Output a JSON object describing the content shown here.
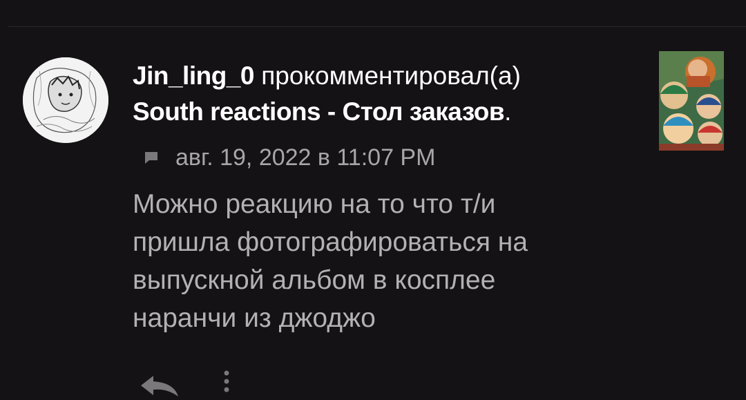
{
  "comment": {
    "username": "Jin_ling_0",
    "action_text": " прокомментировал(а)",
    "post_title": "South reactions - Стол заказов",
    "title_suffix": ".",
    "timestamp": "авг. 19, 2022 в 11:07 PM",
    "text": "Можно реакцию на то что т/и\nпришла фотографироваться на\nвыпускной альбом в косплее\nнаранчи из джоджо"
  },
  "icons": {
    "comment": "comment-icon",
    "reply": "reply-icon",
    "more": "more-vertical-icon"
  },
  "colors": {
    "background": "#141214",
    "primary_text": "#ffffff",
    "secondary_text": "#a8a6a8",
    "body_text": "#b3b1b3"
  }
}
